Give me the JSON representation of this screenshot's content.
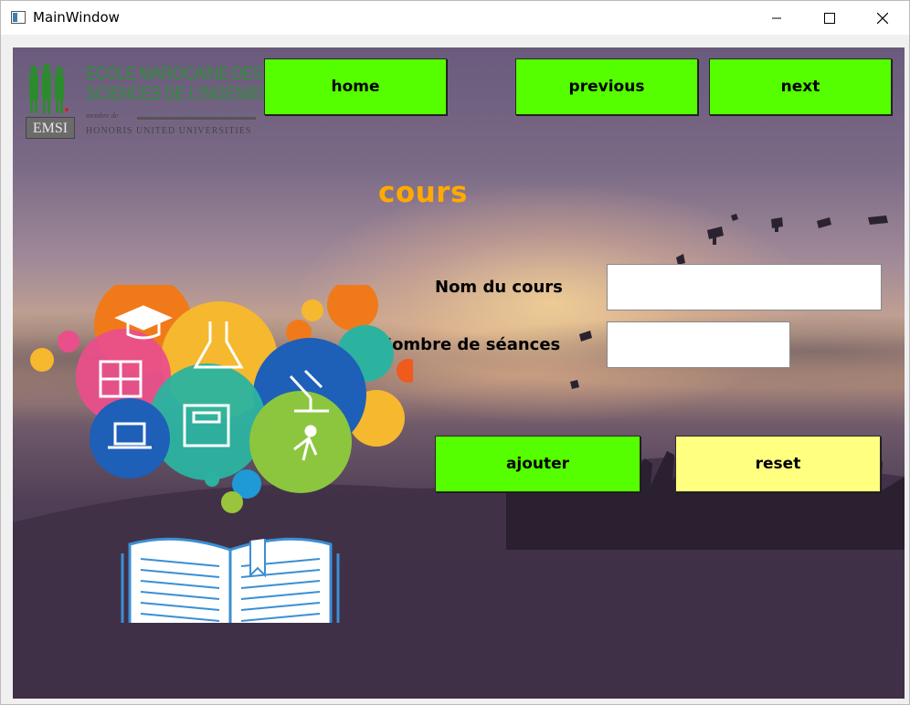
{
  "window": {
    "title": "MainWindow",
    "controls": [
      "minimize-icon",
      "maximize-icon",
      "close-icon"
    ]
  },
  "logo": {
    "line1": "ECOLE MAROCAINE DES",
    "line2": "SCIENCES DE L'INGENIEUR",
    "membre": "membre de",
    "honoris": "HONORIS UNITED UNIVERSITIES",
    "badge": "EMSI"
  },
  "nav": {
    "home_label": "home",
    "previous_label": "previous",
    "next_label": "next"
  },
  "page": {
    "title": "cours"
  },
  "form": {
    "nom_label": "Nom du cours",
    "nom_value": "",
    "seances_label": "Nombre de séances",
    "seances_value": "",
    "ajouter_label": "ajouter",
    "reset_label": "reset"
  },
  "colors": {
    "button_green": "#55ff00",
    "button_yellow": "#ffff80",
    "title_orange": "#ffaa00",
    "logo_green": "#2e8f3a"
  }
}
